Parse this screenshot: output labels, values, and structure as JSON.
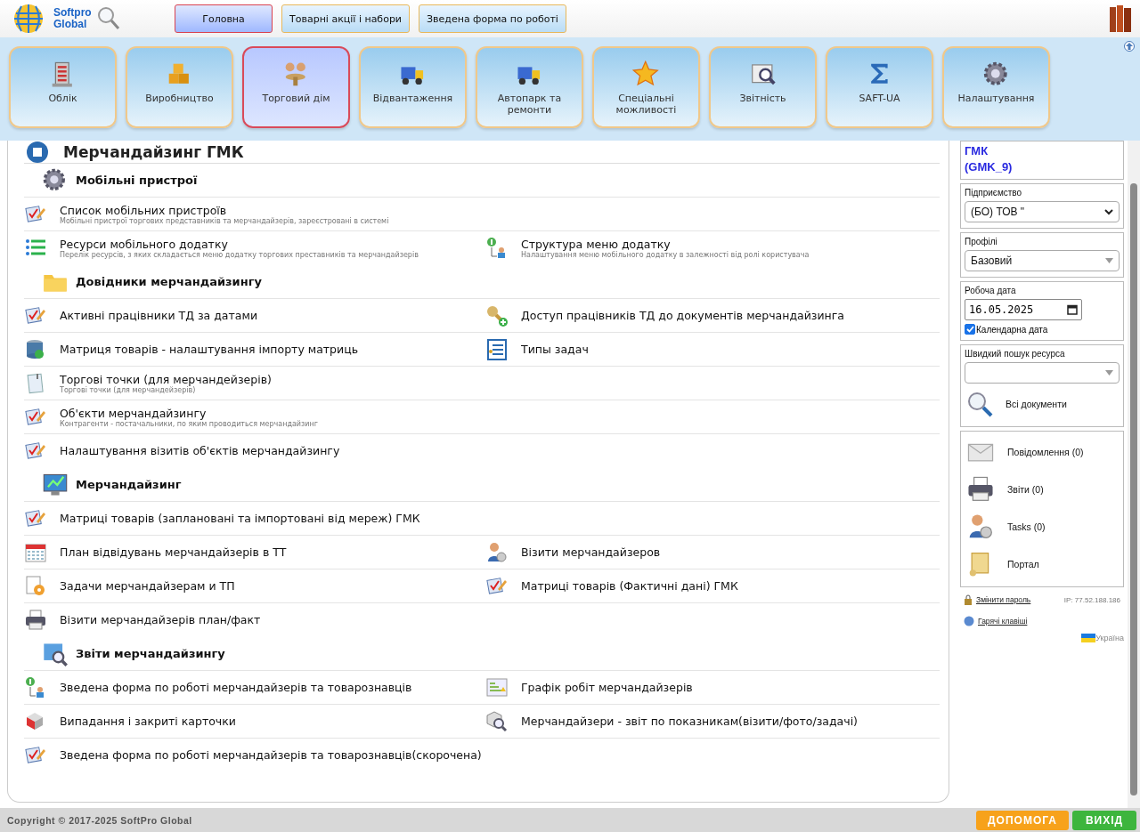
{
  "logo": {
    "line1": "Softpro",
    "line2": "Global"
  },
  "top_tabs": [
    {
      "label": "Головна",
      "selected": true
    },
    {
      "label": "Товарні акції і набори",
      "selected": false
    },
    {
      "label": "Зведена форма по роботі",
      "selected": false
    }
  ],
  "modules": [
    {
      "label": "Облік",
      "kind": "building",
      "selected": false
    },
    {
      "label": "Виробництво",
      "kind": "boxes",
      "selected": false
    },
    {
      "label": "Торговий дім",
      "kind": "people",
      "selected": true
    },
    {
      "label": "Відвантаження",
      "kind": "truck",
      "selected": false
    },
    {
      "label": "Автопарк та ремонти",
      "kind": "truck",
      "selected": false
    },
    {
      "label": "Спеціальні можливості",
      "kind": "star",
      "selected": false
    },
    {
      "label": "Звітність",
      "kind": "report",
      "selected": false
    },
    {
      "label": "SAFT-UA",
      "kind": "sigma",
      "selected": false
    },
    {
      "label": "Налаштування",
      "kind": "gear",
      "selected": false
    }
  ],
  "page_title": "Мерчандайзинг ГМК",
  "sections": [
    {
      "title": "Мобільні пристрої",
      "kind": "gear",
      "rows": [
        [
          {
            "title": "Список мобільних пристроїв",
            "subtitle": "Мобільні пристрої торгових представників та мерчандайзерів, зареєстровані в системі",
            "kind": "check"
          }
        ],
        [
          {
            "title": "Ресурси мобільного додатку",
            "subtitle": "Перелік ресурсів, з яких складається меню додатку торгових преставників та мерчандайзерів",
            "kind": "list"
          },
          {
            "title": "Структура меню додатку",
            "subtitle": "Налаштування меню мобільного додатку в залежності від ролі користувача",
            "kind": "tree"
          }
        ]
      ]
    },
    {
      "title": "Довідники мерчандайзингу",
      "kind": "folder",
      "rows": [
        [
          {
            "title": "Активні працівники ТД за датами",
            "kind": "check"
          },
          {
            "title": "Доступ працівників ТД до документів мерчандайзинга",
            "kind": "key"
          }
        ],
        [
          {
            "title": "Матриця товарів - налаштування імпорту матриць",
            "kind": "db"
          },
          {
            "title": "Типы задач",
            "kind": "tasks"
          }
        ],
        [
          {
            "title": "Торгові точки (для мерчандейзерів)",
            "subtitle": "Торгові точки (для мерчандейзерів)",
            "kind": "note"
          }
        ],
        [
          {
            "title": "Об'єкти мерчандайзингу",
            "subtitle": "Контрагенти - постачальники, по яким проводиться мерчандайзинг",
            "kind": "check"
          }
        ],
        [
          {
            "title": "Налаштування візитів об'єктів мерчандайзингу",
            "kind": "check"
          }
        ]
      ]
    },
    {
      "title": "Мерчандайзинг",
      "kind": "monitor",
      "rows": [
        [
          {
            "title": "Матриці товарів (заплановані та імпортовані від мереж) ГМК",
            "kind": "check"
          }
        ],
        [
          {
            "title": "План відвідувань мерчандайзерів в ТТ",
            "kind": "calendar"
          },
          {
            "title": "Візити мерчандайзеров",
            "kind": "agent"
          }
        ],
        [
          {
            "title": "Задачи мерчандайзерам и ТП",
            "kind": "taskgear"
          },
          {
            "title": "Матриці товарів (Фактичні дані) ГМК",
            "kind": "check"
          }
        ],
        [
          {
            "title": "Візити мерчандайзерів план/факт",
            "kind": "printer"
          }
        ]
      ]
    },
    {
      "title": "Звіти мерчандайзингу",
      "kind": "chart",
      "rows": [
        [
          {
            "title": "Зведена форма по роботі мерчандайзерів та товарознавців",
            "kind": "tree"
          },
          {
            "title": "Графік робіт мерчандайзерів",
            "kind": "grid"
          }
        ],
        [
          {
            "title": "Випадання і закриті карточки",
            "kind": "cube"
          },
          {
            "title": "Мерчандайзери - звіт по показникам(візити/фото/задачі)",
            "kind": "magnifier"
          }
        ],
        [
          {
            "title": "Зведена форма по роботі мерчандайзерів та товарознавців(скорочена)",
            "kind": "check"
          }
        ]
      ]
    }
  ],
  "sidebar": {
    "user_lines": [
      "ГМК",
      "(GMK_9)"
    ],
    "enterprise": {
      "label": "Підприємство",
      "value": "(БО) ТОВ \""
    },
    "profile": {
      "label": "Профілі",
      "value": "Базовий"
    },
    "work_date": {
      "label": "Робоча дата",
      "value": "16.05.2025",
      "calendar_label": "Календарна дата",
      "checked": true
    },
    "quick_search": {
      "label": "Швидкий пошук ресурса",
      "all_docs": "Всі документи"
    },
    "links": [
      {
        "label": "Повідомлення (0)",
        "kind": "mail"
      },
      {
        "label": "Звіти (0)",
        "kind": "printer"
      },
      {
        "label": "Tasks (0)",
        "kind": "agent"
      },
      {
        "label": "Портал",
        "kind": "scroll"
      }
    ],
    "change_password": "Змінити пароль",
    "ip": "IP: 77.52.188.186",
    "hotkeys": "Гарячі клавіші",
    "language": "Україна"
  },
  "footer": {
    "copyright": "Copyright © 2017-2025 SoftPro Global",
    "buttons": [
      {
        "label": "ДОПОМОГА",
        "color": "#f7a21b"
      },
      {
        "label": "ВИХІД",
        "color": "#3db53d"
      }
    ]
  }
}
